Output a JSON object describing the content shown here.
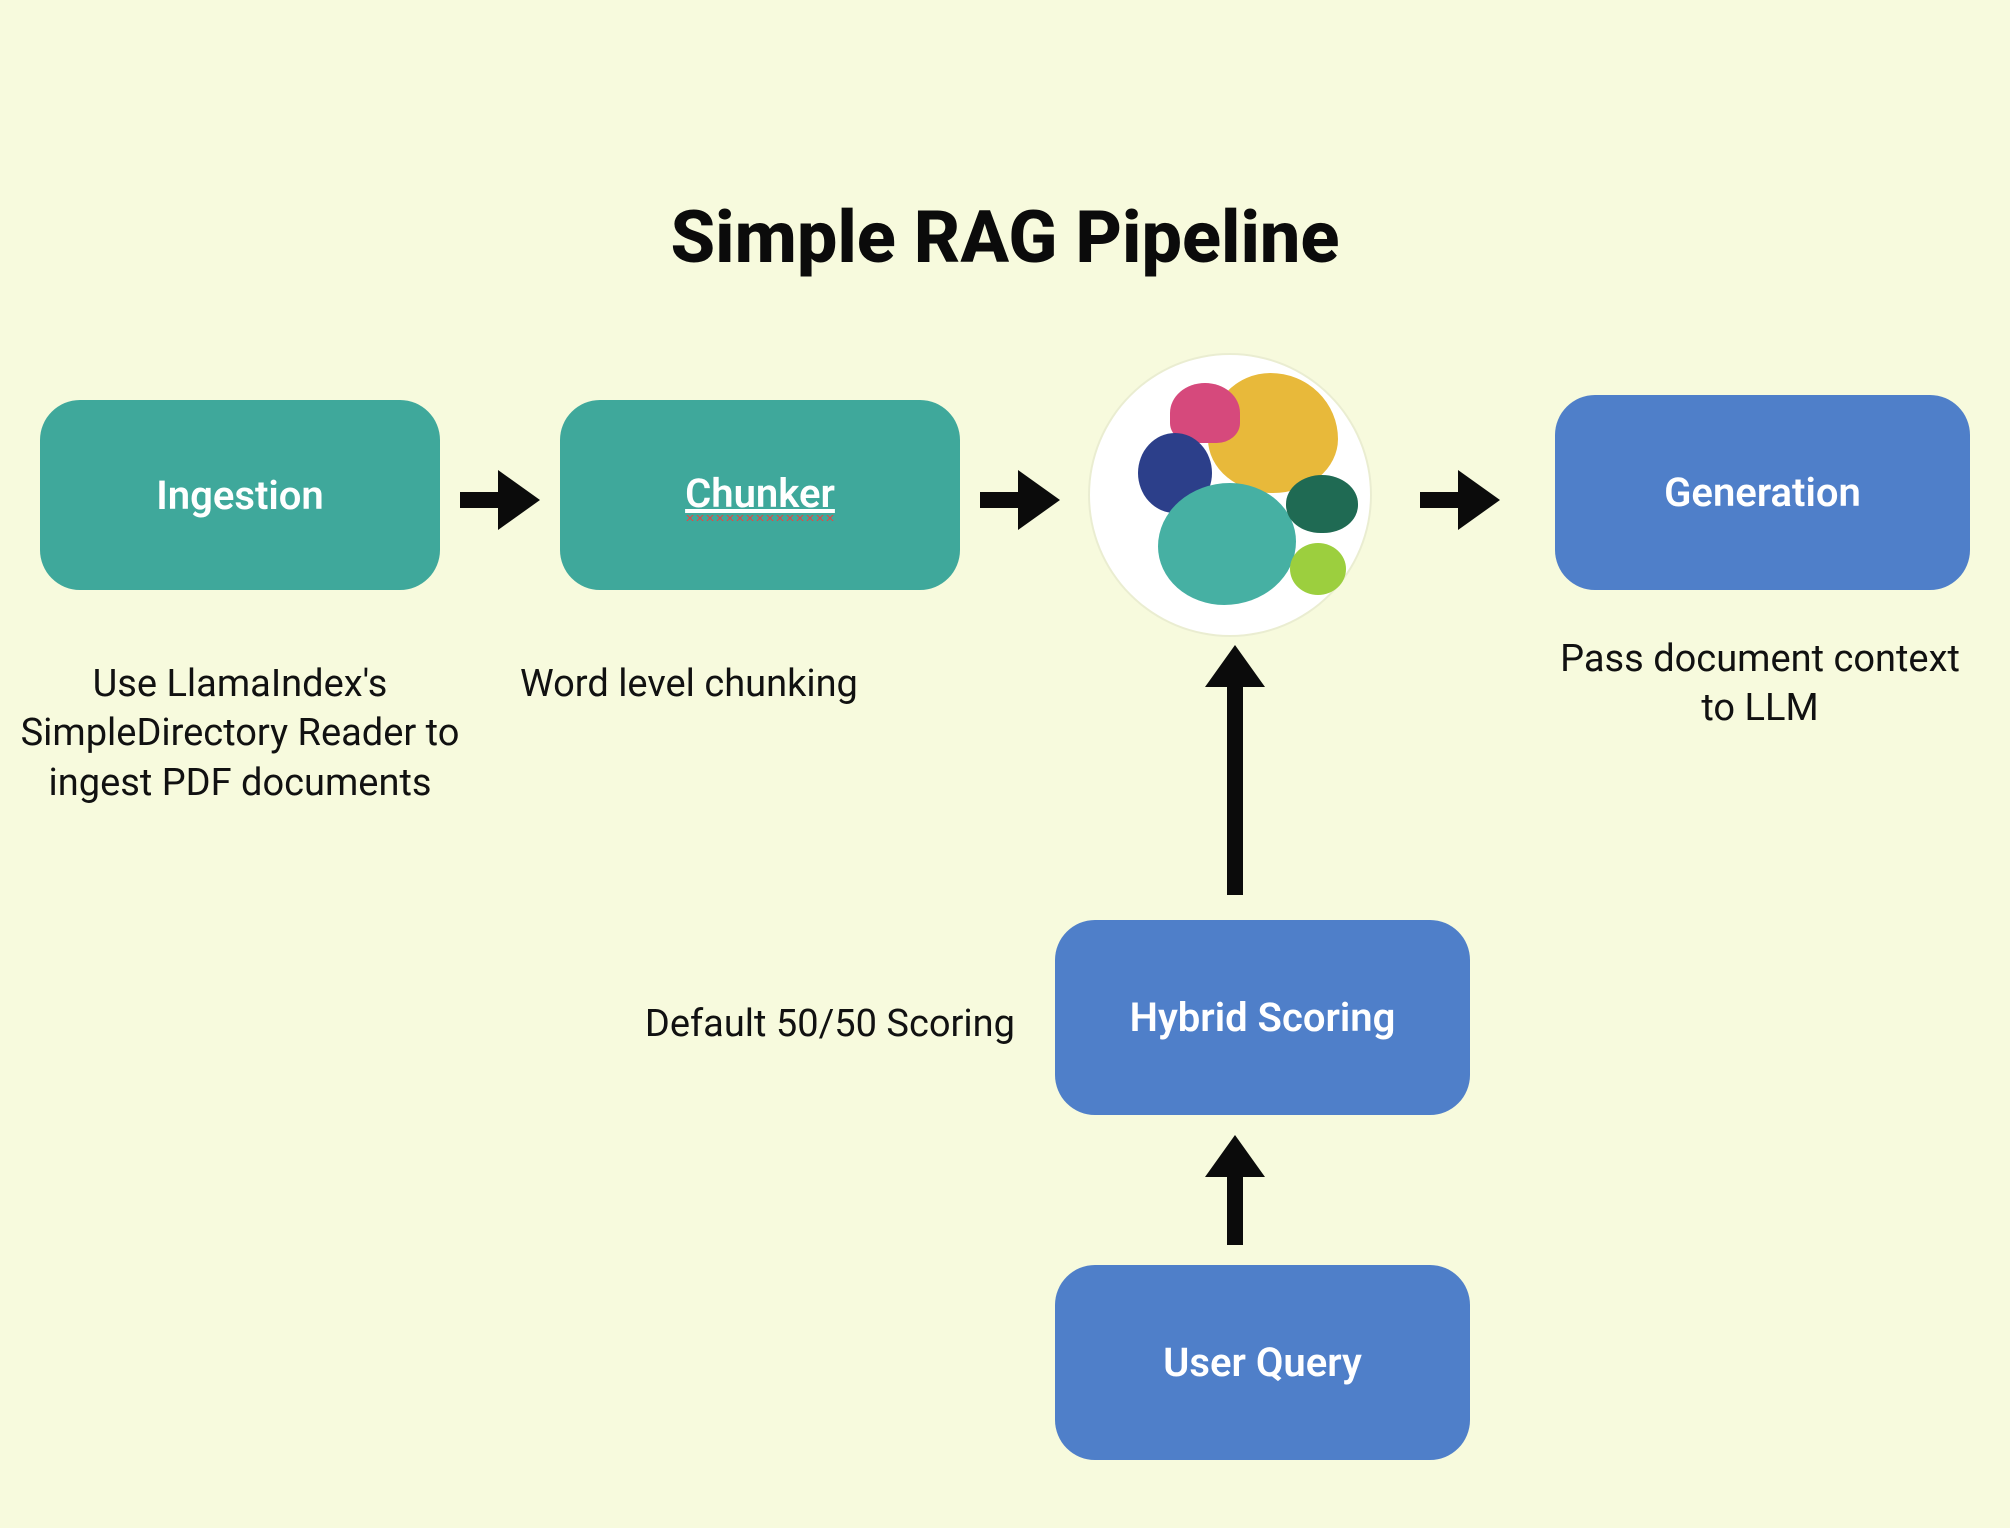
{
  "title": "Simple RAG Pipeline",
  "nodes": {
    "ingestion": {
      "label": "Ingestion"
    },
    "chunker": {
      "label": "Chunker"
    },
    "generation": {
      "label": "Generation"
    },
    "hybrid": {
      "label": "Hybrid Scoring"
    },
    "userquery": {
      "label": "User Query"
    }
  },
  "captions": {
    "ingestion": "Use LlamaIndex's SimpleDirectory Reader to ingest PDF documents",
    "chunker": "Word level chunking",
    "generation": "Pass document context to LLM",
    "hybrid": "Default 50/50 Scoring"
  },
  "icons": {
    "elastic": "elastic-cluster-logo"
  },
  "colors": {
    "teal": "#3fa89b",
    "blue": "#4f7fc9",
    "bg": "#f7fadd",
    "black": "#0b0b0b"
  }
}
